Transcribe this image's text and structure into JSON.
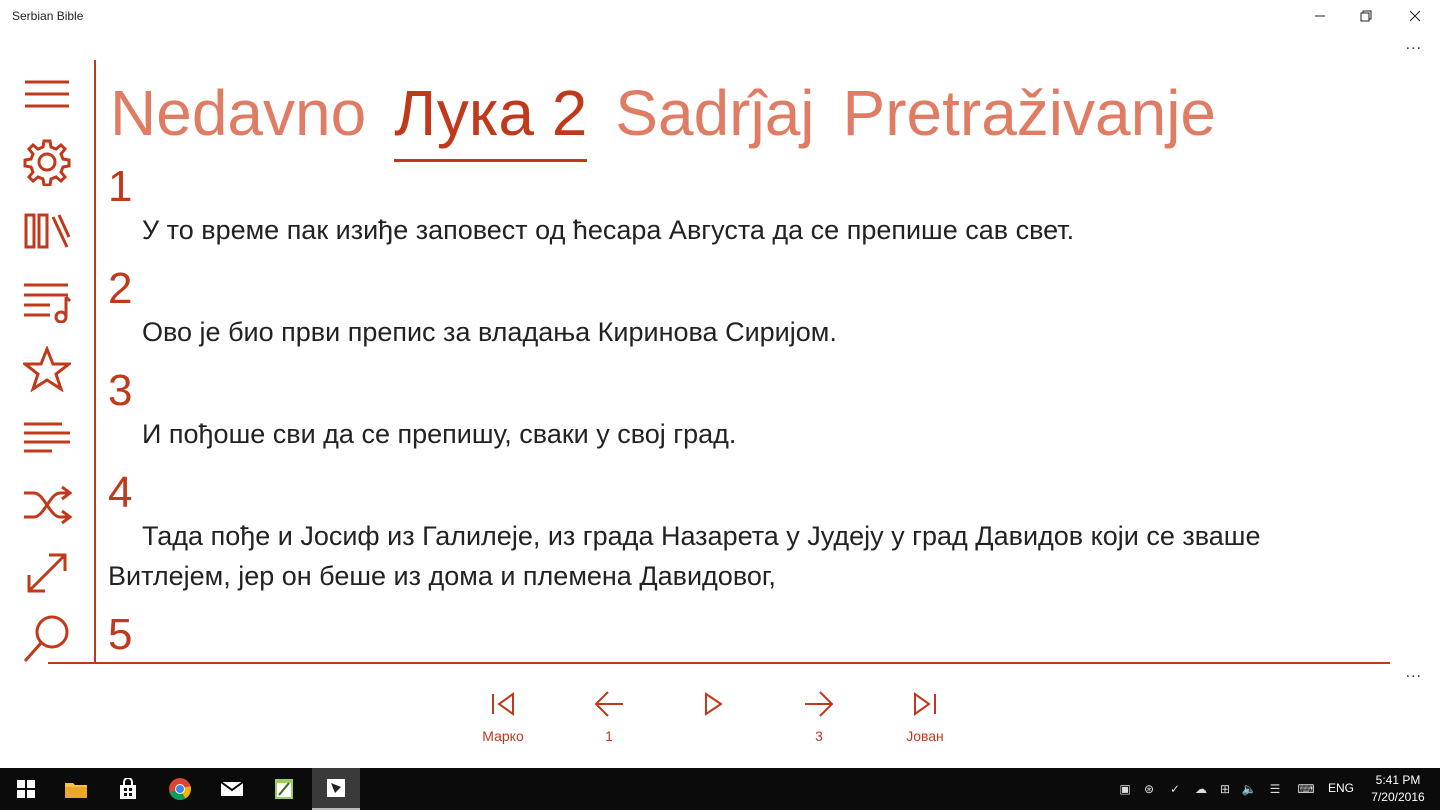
{
  "window": {
    "title": "Serbian Bible",
    "more_label": "..."
  },
  "sidebar": {
    "icons": [
      "menu-icon",
      "gear-icon",
      "library-icon",
      "playlist-icon",
      "star-icon",
      "text-lines-icon",
      "shuffle-icon",
      "resize-icon",
      "search-icon"
    ]
  },
  "tabs": [
    {
      "label": "Nedavno",
      "active": false
    },
    {
      "label": "Лука 2",
      "active": true
    },
    {
      "label": "Sadrĵaj",
      "active": false
    },
    {
      "label": "Pretraživanje",
      "active": false
    }
  ],
  "verses": [
    {
      "num": "1",
      "text": "У то време пак изиђе заповест од ћесара Августа да се препише сав свет."
    },
    {
      "num": "2",
      "text": "Ово је био први препис за владања Киринова Сиријом."
    },
    {
      "num": "3",
      "text": "И пођоше сви да се препишу, сваки у свој град."
    },
    {
      "num": "4",
      "text": "Тада пође и Јосиф из Галилеје, из града Назарета у Јудеју у град Давидов који се зваше Витлејем, јер он беше из дома и племена Давидовог,"
    },
    {
      "num": "5",
      "text": ""
    }
  ],
  "navigation": {
    "first_label": "Марко",
    "prev_label": "1",
    "play_label": "",
    "next_label": "3",
    "last_label": "Јован",
    "more_label": "..."
  },
  "taskbar": {
    "language": "ENG",
    "time": "5:41 PM",
    "date": "7/20/2016"
  },
  "colors": {
    "accent": "#c0391b",
    "accent_light": "#e07c64",
    "taskbar": "#0b0b0b"
  }
}
